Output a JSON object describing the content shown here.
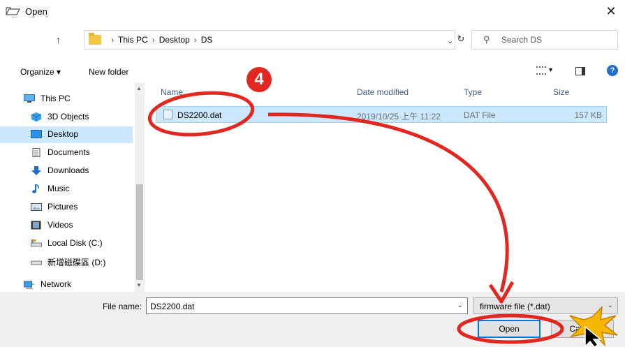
{
  "window": {
    "title": "Open",
    "close_label": "✕"
  },
  "address": {
    "back": "←",
    "forward": "→",
    "recent": "⌄",
    "up": "↑",
    "path": [
      "This PC",
      "Desktop",
      "DS"
    ],
    "refresh": "↻",
    "search_placeholder": "Search DS"
  },
  "toolbar": {
    "organize": "Organize ▾",
    "new_folder": "New folder",
    "help": "?"
  },
  "sidebar": {
    "items": [
      {
        "label": "This PC",
        "icon": "pc-icon"
      },
      {
        "label": "3D Objects",
        "icon": "cube-icon"
      },
      {
        "label": "Desktop",
        "icon": "desktop-icon",
        "selected": true
      },
      {
        "label": "Documents",
        "icon": "document-icon"
      },
      {
        "label": "Downloads",
        "icon": "download-icon"
      },
      {
        "label": "Music",
        "icon": "music-icon"
      },
      {
        "label": "Pictures",
        "icon": "pictures-icon"
      },
      {
        "label": "Videos",
        "icon": "video-icon"
      },
      {
        "label": "Local Disk (C:)",
        "icon": "drive-icon"
      },
      {
        "label": "新增磁碟區 (D:)",
        "icon": "drive-icon"
      },
      {
        "label": "Network",
        "icon": "network-icon"
      }
    ]
  },
  "columns": {
    "name": "Name",
    "date": "Date modified",
    "type": "Type",
    "size": "Size"
  },
  "files": [
    {
      "name": "DS2200.dat",
      "date": "2019/10/25 上午 11:22",
      "type": "DAT File",
      "size": "157 KB"
    }
  ],
  "footer": {
    "file_name_label": "File name:",
    "file_name_value": "DS2200.dat",
    "file_type_value": "firmware file (*.dat)",
    "open_label": "Open",
    "cancel_label": "Cancel"
  },
  "annotation": {
    "step": "4"
  },
  "colors": {
    "accent": "#0078d7",
    "selection": "#cce8ff",
    "annotation_red": "#e3261f"
  }
}
